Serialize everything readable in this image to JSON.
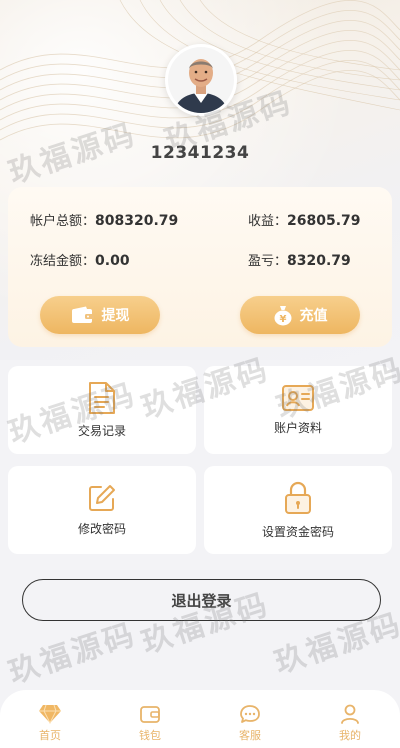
{
  "profile": {
    "user_id": "12341234",
    "avatar_icon": "user-avatar-photo"
  },
  "balance": {
    "total_label": "帐户总额：",
    "total_value": "808320.79",
    "income_label": "收益：",
    "income_value": "26805.79",
    "frozen_label": "冻结金额：",
    "frozen_value": "0.00",
    "pnl_label": "盈亏：",
    "pnl_value": "8320.79",
    "withdraw_label": "提现",
    "recharge_label": "充值"
  },
  "menu": {
    "transactions": "交易记录",
    "account_info": "账户资料",
    "change_password": "修改密码",
    "fund_password": "设置资金密码"
  },
  "logout_label": "退出登录",
  "tabbar": {
    "home": "首页",
    "wallet": "钱包",
    "service": "客服",
    "mine": "我的"
  },
  "watermark": "玖福源码",
  "colors": {
    "accent": "#eeb661",
    "accent_light": "#f7cf8c",
    "tab_label": "#e8b46a",
    "page_bg": "#f3f3f6"
  }
}
